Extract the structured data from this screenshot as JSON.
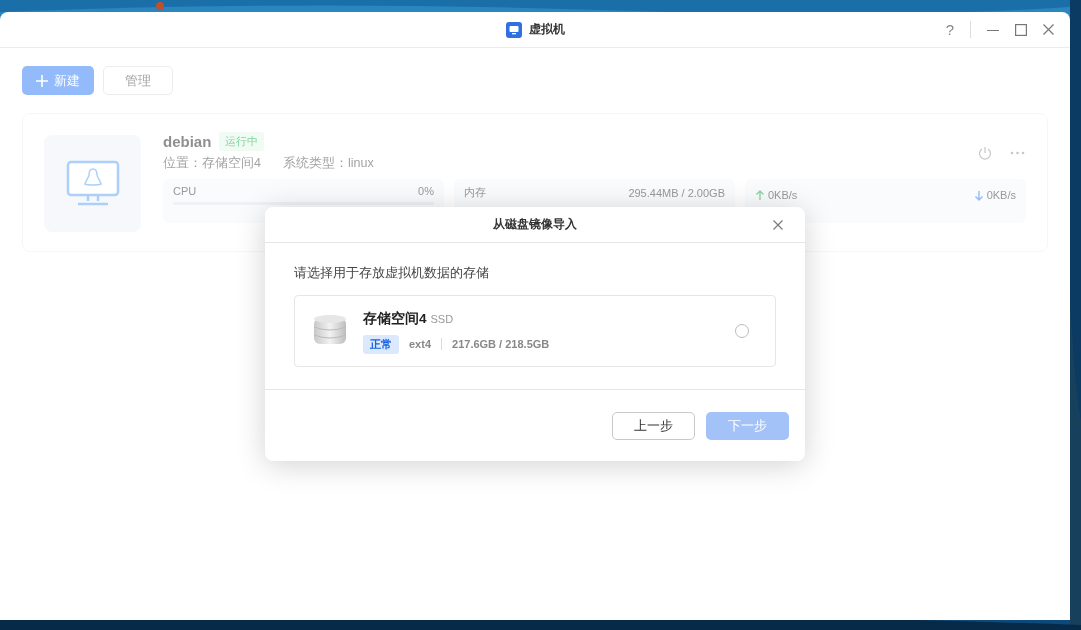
{
  "window": {
    "title": "虚拟机",
    "help": "?"
  },
  "toolbar": {
    "buttons": [
      {
        "label": "新建",
        "kind": "primary"
      },
      {
        "label": "管理",
        "kind": "default"
      }
    ]
  },
  "vm": {
    "name": "debian",
    "status": "运行中",
    "location": "位置：存储空间4",
    "os_type": "系统类型：linux",
    "metrics": [
      {
        "kind": "usage",
        "label": "CPU",
        "reading": "0%",
        "level": 0
      },
      {
        "kind": "text",
        "label": "内存",
        "reading": "295.44MB / 2.00GB"
      },
      {
        "kind": "network",
        "up": "0KB/s",
        "down": "0KB/s"
      }
    ]
  },
  "dialog": {
    "title": "从磁盘镜像导入",
    "prompt": "请选择用于存放虚拟机数据的存储",
    "storages": [
      {
        "name": "存储空间4",
        "type": "SSD",
        "status": "正常",
        "filesystem": "ext4",
        "usage": "217.6GB / 218.5GB",
        "selected": false
      }
    ],
    "buttons": [
      {
        "label": "上一步",
        "kind": "secondary",
        "disabled": false
      },
      {
        "label": "下一步",
        "kind": "primary",
        "disabled": true
      }
    ]
  }
}
